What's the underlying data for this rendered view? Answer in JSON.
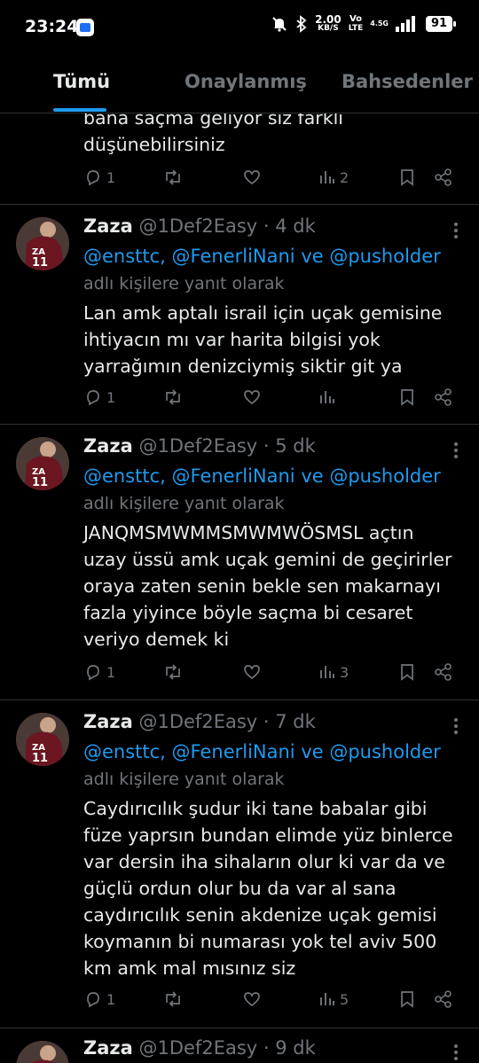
{
  "status_bar": {
    "time": "23:24",
    "net_speed": "2.00",
    "net_unit": "KB/S",
    "volte_top": "Vo",
    "volte_bottom": "LTE",
    "signal_label": "4.5G",
    "battery": "91",
    "icons": [
      "mute-icon",
      "bluetooth-icon",
      "signal-icon",
      "battery-icon"
    ]
  },
  "tabs": [
    {
      "label": "Tümü",
      "active": true
    },
    {
      "label": "Onaylanmış",
      "active": false
    },
    {
      "label": "Bahsedenler",
      "active": false
    }
  ],
  "accent_color": "#1d9bf0",
  "tweets": [
    {
      "partial": true,
      "body": "bana saçma geliyor siz farklı\ndüşünebilirsiniz",
      "replies": "1",
      "views": "2"
    },
    {
      "name": "Zaza",
      "handle": "@1Def2Easy",
      "time": "· 4 dk",
      "mentions": "@ensttc, @FenerliNani ve @pusholder",
      "reply_hint": "adlı kişilere yanıt olarak",
      "body": "Lan amk aptalı israil için uçak gemisine\nihtiyacın mı var harita bilgisi yok\nyarrağımın denizciymiş siktir git ya",
      "replies": "1",
      "views": ""
    },
    {
      "name": "Zaza",
      "handle": "@1Def2Easy",
      "time": "· 5 dk",
      "mentions": "@ensttc, @FenerliNani ve @pusholder",
      "reply_hint": "adlı kişilere yanıt olarak",
      "body": "JANQMSMWMMSMWMWÖSMSL açtın\nuzay üssü amk uçak gemini de geçirirler\noraya zaten senin bekle sen makarnayı\nfazla yiyince böyle saçma bi cesaret\nveriyo demek ki",
      "replies": "1",
      "views": "3"
    },
    {
      "name": "Zaza",
      "handle": "@1Def2Easy",
      "time": "· 7 dk",
      "mentions": "@ensttc, @FenerliNani ve @pusholder",
      "reply_hint": "adlı kişilere yanıt olarak",
      "body": "Caydırıcılık şudur iki tane babalar gibi\nfüze yaprsın bundan elimde yüz binlerce\nvar dersin iha sihaların olur ki var da ve\ngüçlü ordun olur bu da var al sana\ncaydırıcılık senin akdenize uçak gemisi\nkoymanın bi numarası yok tel aviv 500\nkm amk mal mısınız siz",
      "replies": "1",
      "views": "5"
    },
    {
      "partial": true,
      "name": "Zaza",
      "handle": "@1Def2Easy",
      "time": "· 9 dk"
    }
  ]
}
